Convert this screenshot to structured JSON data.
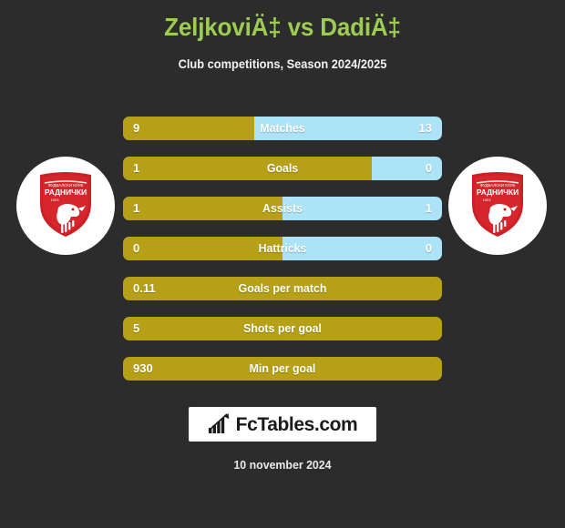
{
  "header": {
    "title": "ZeljkoviÄ‡ vs DadiÄ‡",
    "subtitle": "Club competitions, Season 2024/2025"
  },
  "colors": {
    "background": "#2c2c2c",
    "title": "#9ccc52",
    "gold": "#b5a017",
    "blue": "#ade3f7",
    "crest_red": "#cc2026",
    "text": "#ffffff"
  },
  "crests": {
    "left": {
      "club_line1": "ФУДБАЛСКИ КЛУБ",
      "club_line2": "РАДНИЧКИ",
      "year": "1923"
    },
    "right": {
      "club_line1": "ФУДБАЛСКИ КЛУБ",
      "club_line2": "РАДНИЧКИ",
      "year": "1923"
    }
  },
  "chart_data": {
    "type": "bar",
    "title": "ZeljkoviÄ‡ vs DadiÄ‡",
    "subtitle": "Club competitions, Season 2024/2025",
    "orientation": "horizontal-diverging",
    "series": [
      {
        "name": "ZeljkoviÄ‡",
        "color": "#b5a017",
        "side": "left"
      },
      {
        "name": "DadiÄ‡",
        "color": "#ade3f7",
        "side": "right"
      }
    ],
    "categories": [
      "Matches",
      "Goals",
      "Assists",
      "Hattricks",
      "Goals per match",
      "Shots per goal",
      "Min per goal"
    ],
    "rows": [
      {
        "label": "Matches",
        "left": "9",
        "right": "13",
        "left_pct": 41,
        "has_right": true
      },
      {
        "label": "Goals",
        "left": "1",
        "right": "0",
        "left_pct": 78,
        "has_right": true
      },
      {
        "label": "Assists",
        "left": "1",
        "right": "1",
        "left_pct": 50,
        "has_right": true
      },
      {
        "label": "Hattricks",
        "left": "0",
        "right": "0",
        "left_pct": 50,
        "has_right": true
      },
      {
        "label": "Goals per match",
        "left": "0.11",
        "right": "",
        "left_pct": 100,
        "has_right": false
      },
      {
        "label": "Shots per goal",
        "left": "5",
        "right": "",
        "left_pct": 100,
        "has_right": false
      },
      {
        "label": "Min per goal",
        "left": "930",
        "right": "",
        "left_pct": 100,
        "has_right": false
      }
    ]
  },
  "footer": {
    "logo_text": "FcTables.com",
    "logo_icon": "bar-chart-arrow-icon",
    "date": "10 november 2024"
  }
}
